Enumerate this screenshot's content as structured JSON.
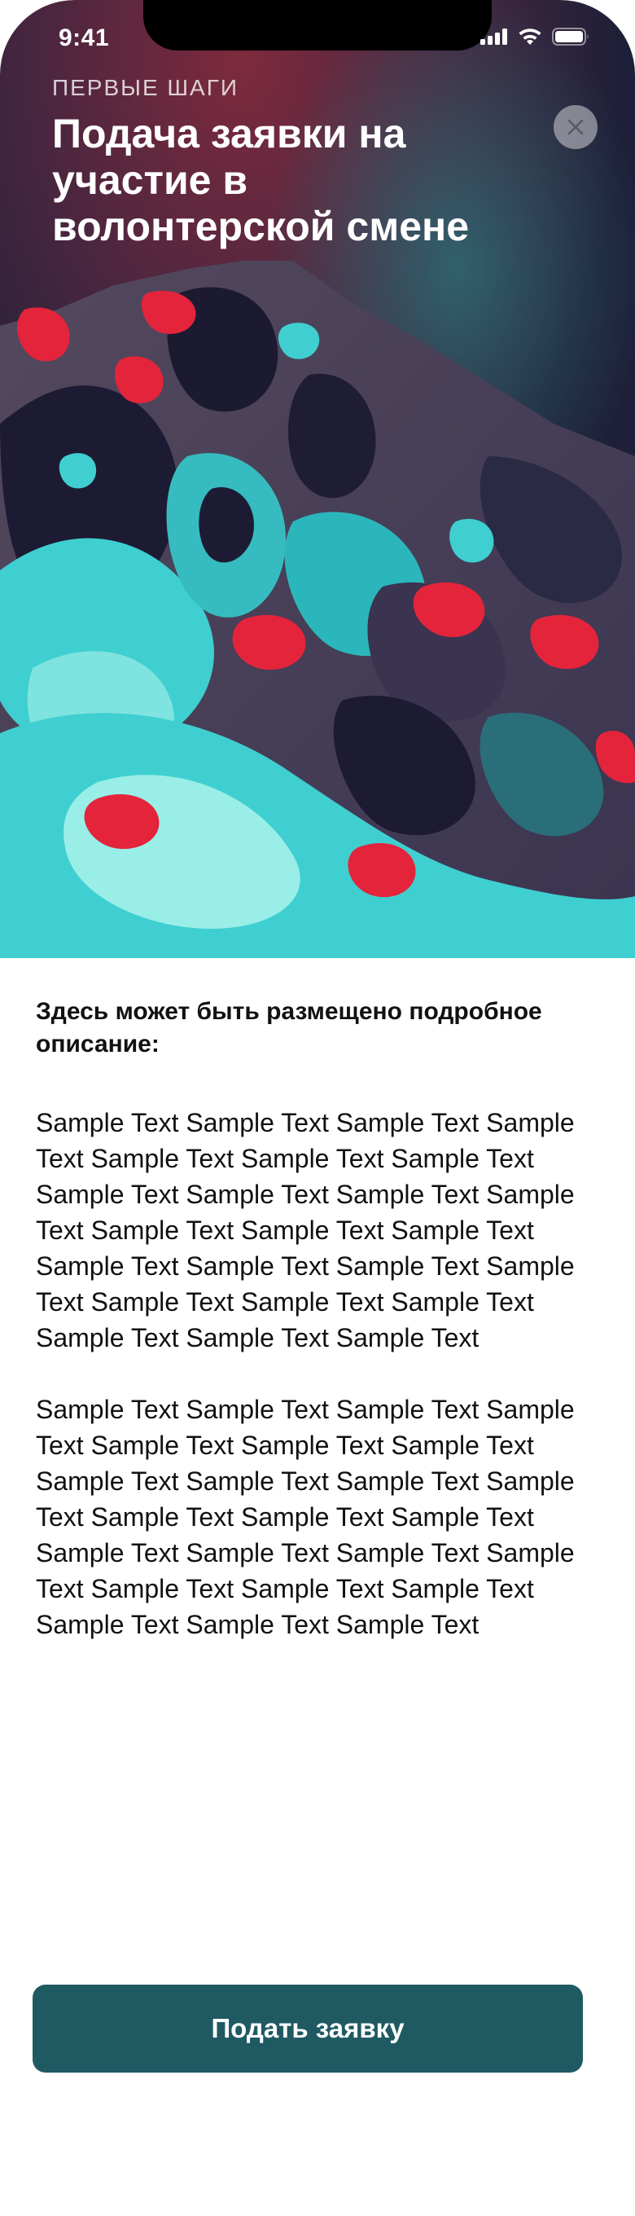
{
  "status_bar": {
    "time": "9:41",
    "icons": [
      "cellular-signal-icon",
      "wifi-icon",
      "battery-icon"
    ]
  },
  "header": {
    "eyebrow": "ПЕРВЫЕ ШАГИ",
    "title": "Подача заявки на участие в волонтерской смене",
    "close_icon": "close-icon"
  },
  "hero": {
    "image": "abstract-mountain-image",
    "colors": [
      "#1e1f3a",
      "#3fcfd0",
      "#e3243b",
      "#4a3c55"
    ]
  },
  "body": {
    "heading": "Здесь может быть размещено подробное описание:",
    "paragraph_1": "Sample Text Sample Text Sample Text Sample Text Sample Text Sample Text Sample Text Sample Text Sample Text Sample Text Sample Text Sample Text Sample Text Sample Text Sample Text Sample Text Sample Text Sample Text Sample Text Sample Text Sample Text Sample Text Sample Text Sample Text",
    "paragraph_2": "Sample Text Sample Text Sample Text Sample Text Sample Text Sample Text Sample Text Sample Text Sample Text Sample Text Sample Text Sample Text Sample Text Sample Text Sample Text Sample Text Sample Text Sample Text Sample Text Sample Text Sample Text Sample Text Sample Text Sample Text"
  },
  "cta": {
    "label": "Подать заявку",
    "color": "#1f5a63"
  }
}
